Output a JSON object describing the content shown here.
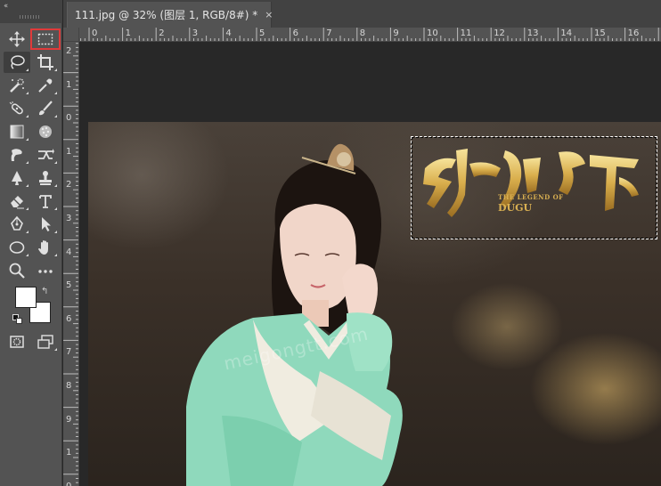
{
  "document": {
    "tab_title": "111.jpg @ 32% (图层 1, RGB/8#) *",
    "close_glyph": "×"
  },
  "toolbar": {
    "collapse_glyph": "‹‹",
    "tools": [
      {
        "name": "move-tool",
        "icon": "move-icon"
      },
      {
        "name": "rectangular-marquee-tool",
        "icon": "marquee-icon",
        "highlighted": true
      },
      {
        "name": "lasso-tool",
        "icon": "lasso-icon",
        "active": true
      },
      {
        "name": "crop-tool",
        "icon": "crop-icon"
      },
      {
        "name": "quick-selection-tool",
        "icon": "quick-selection-icon"
      },
      {
        "name": "eyedropper-tool",
        "icon": "eyedropper-icon"
      },
      {
        "name": "spot-healing-tool",
        "icon": "healing-brush-icon"
      },
      {
        "name": "brush-tool",
        "icon": "brush-icon"
      },
      {
        "name": "gradient-tool",
        "icon": "gradient-icon"
      },
      {
        "name": "blur-tool",
        "icon": "blur-icon"
      },
      {
        "name": "smudge-tool",
        "icon": "smudge-icon"
      },
      {
        "name": "history-brush-tool",
        "icon": "history-brush-icon"
      },
      {
        "name": "dodge-tool",
        "icon": "dodge-icon"
      },
      {
        "name": "clone-stamp-tool",
        "icon": "stamp-icon"
      },
      {
        "name": "eraser-tool",
        "icon": "eraser-icon"
      },
      {
        "name": "type-tool",
        "icon": "type-icon"
      },
      {
        "name": "pen-tool",
        "icon": "pen-icon"
      },
      {
        "name": "path-selection-tool",
        "icon": "arrow-icon"
      },
      {
        "name": "ellipse-tool",
        "icon": "ellipse-icon"
      },
      {
        "name": "hand-tool",
        "icon": "hand-icon"
      },
      {
        "name": "zoom-tool",
        "icon": "zoom-icon"
      },
      {
        "name": "more-tools",
        "icon": "ellipsis-icon"
      }
    ],
    "foreground_color": "#ffffff",
    "background_color": "#ffffff",
    "swap_glyph": "↰"
  },
  "rulers": {
    "horizontal_labels": [
      "0",
      "1",
      "2",
      "3",
      "4",
      "5",
      "6",
      "7",
      "8",
      "9",
      "10",
      "11",
      "12",
      "13",
      "14",
      "15",
      "16"
    ],
    "vertical_labels": [
      "2",
      "1",
      "0",
      "1",
      "2",
      "3",
      "4",
      "5",
      "6",
      "7",
      "8",
      "9",
      "1",
      "0"
    ]
  },
  "image": {
    "logo_sub1": "THE LEGEND OF",
    "logo_sub2": "DUGU",
    "watermark": "meigongtt.com"
  },
  "colors": {
    "selection_highlight": "#e03a3a",
    "logo_gold": "#d9b052",
    "robe": "#8fd9bc"
  }
}
